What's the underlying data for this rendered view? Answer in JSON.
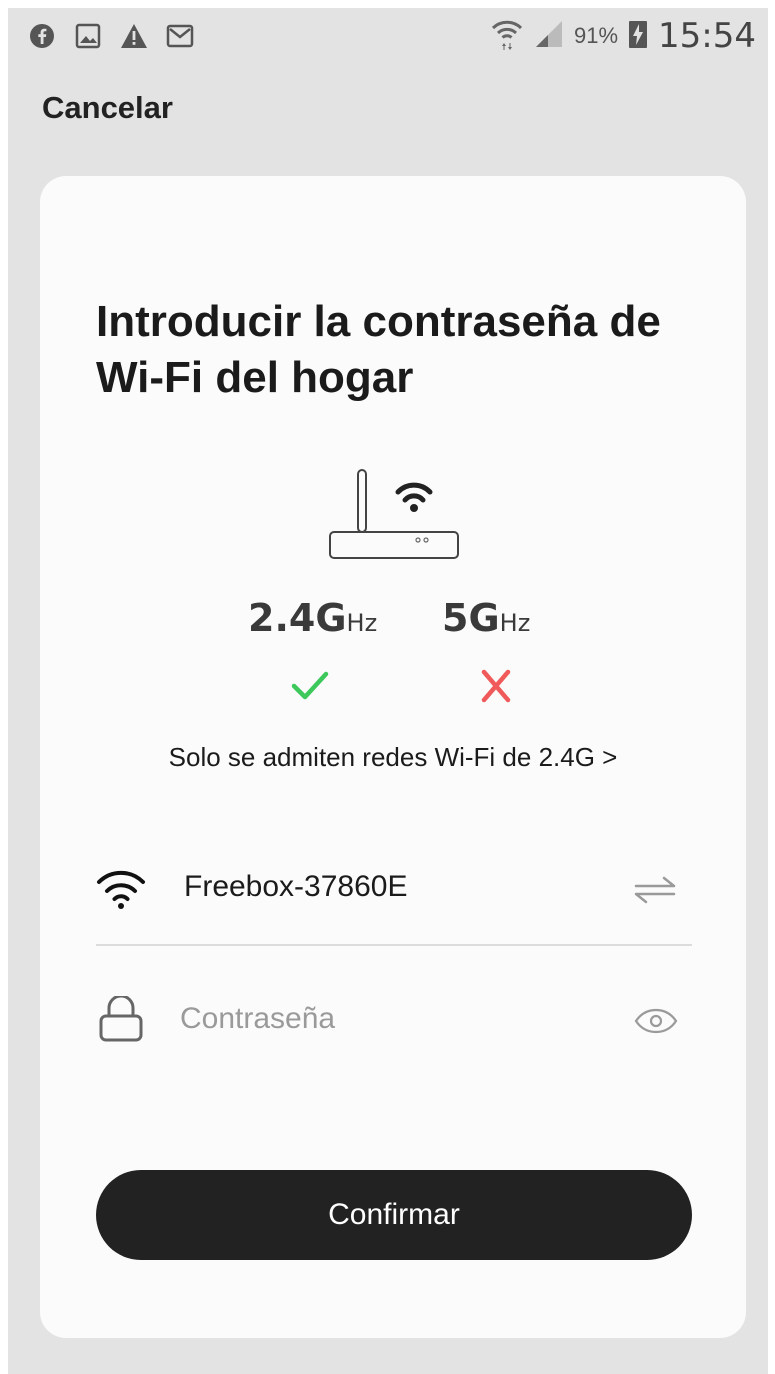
{
  "status_bar": {
    "left_icons": [
      "facebook-icon",
      "gallery-icon",
      "warning-icon",
      "gmail-icon"
    ],
    "battery_percent": "91%",
    "time": "15:54"
  },
  "header": {
    "cancel_label": "Cancelar"
  },
  "card": {
    "title": "Introducir la contraseña de Wi-Fi del hogar",
    "bands": [
      {
        "main": "2.4G",
        "unit": "Hz",
        "supported": true
      },
      {
        "main": "5G",
        "unit": "Hz",
        "supported": false
      }
    ],
    "support_link": "Solo se admiten redes Wi-Fi de 2.4G >",
    "network_name": "Freebox-37860E",
    "password_placeholder": "Contraseña",
    "confirm_label": "Confirmar"
  },
  "colors": {
    "check": "#3cc85a",
    "cross": "#f05a5a",
    "button": "#222222"
  }
}
